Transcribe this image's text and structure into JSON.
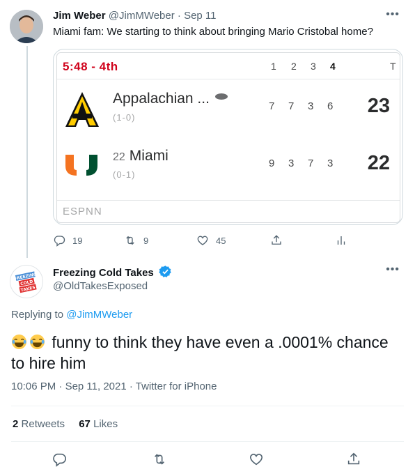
{
  "tweet1": {
    "name": "Jim Weber",
    "handle": "@JimMWeber",
    "separator": "·",
    "date": "Sep 11",
    "text": "Miami fam: We starting to think about bringing Mario Cristobal home?",
    "actions": {
      "replies": "19",
      "retweets": "9",
      "likes": "45"
    },
    "scorecard": {
      "clock": "5:48 - 4th",
      "quarters": [
        "1",
        "2",
        "3",
        "4"
      ],
      "total_label": "T",
      "network": "ESPNN",
      "teams": [
        {
          "name": "Appalachian ...",
          "rank": "",
          "record": "(1-0)",
          "quarters": [
            "7",
            "7",
            "3",
            "6"
          ],
          "total": "23"
        },
        {
          "name": "Miami",
          "rank": "22",
          "record": "(0-1)",
          "quarters": [
            "9",
            "3",
            "7",
            "3"
          ],
          "total": "22"
        }
      ]
    }
  },
  "tweet2": {
    "name": "Freezing Cold Takes",
    "handle": "@OldTakesExposed",
    "avatar_text": [
      "FREEZING",
      "COLD",
      "TAKES"
    ],
    "replying_prefix": "Replying to",
    "replying_handle": "@JimMWeber",
    "text": "funny to think they have even a .0001% chance to hire him",
    "time": "10:06 PM",
    "date": "Sep 11, 2021",
    "source": "Twitter for iPhone",
    "retweets_count": "2",
    "retweets_label": "Retweets",
    "likes_count": "67",
    "likes_label": "Likes"
  },
  "colors": {
    "accent": "#1d9bf0",
    "clock_red": "#d0021b",
    "miami_orange": "#f47321",
    "miami_green": "#005030",
    "app_gold": "#ffcc00"
  },
  "icons": [
    "more-icon",
    "reply-icon",
    "retweet-icon",
    "like-icon",
    "share-icon",
    "analytics-icon",
    "verified-icon",
    "laughing-emoji"
  ]
}
